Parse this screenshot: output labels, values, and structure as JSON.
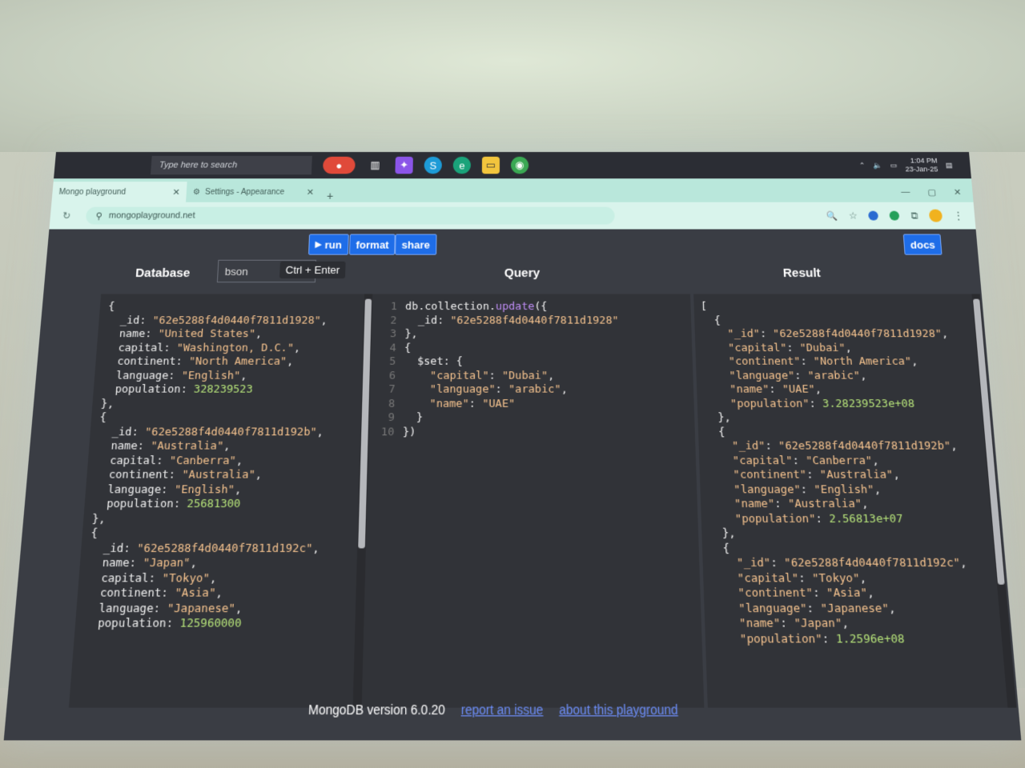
{
  "taskbar": {
    "search_placeholder": "Type here to search",
    "time": "1:04 PM",
    "date": "23-Jan-25"
  },
  "browser": {
    "tabs": [
      {
        "label": "Mongo playground"
      },
      {
        "label": "Settings - Appearance"
      }
    ],
    "url": "mongoplayground.net"
  },
  "toolbar": {
    "run_label": "run",
    "format_label": "format",
    "share_label": "share",
    "docs_label": "docs",
    "run_tooltip": "Ctrl + Enter"
  },
  "panels": {
    "database_title": "Database",
    "mode_value": "bson",
    "query_title": "Query",
    "result_title": "Result"
  },
  "database_lines": [
    "{",
    "  _id: \"62e5288f4d0440f7811d1928\",",
    "  name: \"United States\",",
    "  capital: \"Washington, D.C.\",",
    "  continent: \"North America\",",
    "  language: \"English\",",
    "  population: 328239523",
    "},",
    "{",
    "  _id: \"62e5288f4d0440f7811d192b\",",
    "  name: \"Australia\",",
    "  capital: \"Canberra\",",
    "  continent: \"Australia\",",
    "  language: \"English\",",
    "  population: 25681300",
    "},",
    "{",
    "  _id: \"62e5288f4d0440f7811d192c\",",
    "  name: \"Japan\",",
    "  capital: \"Tokyo\",",
    "  continent: \"Asia\",",
    "  language: \"Japanese\",",
    "  population: 125960000"
  ],
  "query_lines": [
    {
      "num": "1",
      "text": "db.collection.update({"
    },
    {
      "num": "2",
      "text": "  _id: \"62e5288f4d0440f7811d1928\""
    },
    {
      "num": "3",
      "text": "},"
    },
    {
      "num": "4",
      "text": "{"
    },
    {
      "num": "5",
      "text": "  $set: {"
    },
    {
      "num": "6",
      "text": "    \"capital\": \"Dubai\","
    },
    {
      "num": "7",
      "text": "    \"language\": \"arabic\","
    },
    {
      "num": "8",
      "text": "    \"name\": \"UAE\""
    },
    {
      "num": "9",
      "text": "  }"
    },
    {
      "num": "10",
      "text": "})"
    }
  ],
  "result_lines": [
    "[",
    "  {",
    "    \"_id\": \"62e5288f4d0440f7811d1928\",",
    "    \"capital\": \"Dubai\",",
    "    \"continent\": \"North America\",",
    "    \"language\": \"arabic\",",
    "    \"name\": \"UAE\",",
    "    \"population\": 3.28239523e+08",
    "  },",
    "  {",
    "    \"_id\": \"62e5288f4d0440f7811d192b\",",
    "    \"capital\": \"Canberra\",",
    "    \"continent\": \"Australia\",",
    "    \"language\": \"English\",",
    "    \"name\": \"Australia\",",
    "    \"population\": 2.56813e+07",
    "  },",
    "  {",
    "    \"_id\": \"62e5288f4d0440f7811d192c\",",
    "    \"capital\": \"Tokyo\",",
    "    \"continent\": \"Asia\",",
    "    \"language\": \"Japanese\",",
    "    \"name\": \"Japan\",",
    "    \"population\": 1.2596e+08"
  ],
  "footer": {
    "version": "MongoDB version 6.0.20",
    "report_link": "report an issue",
    "about_link": "about this playground"
  },
  "colors": {
    "accent": "#1e6de8",
    "editor_bg": "#313338",
    "string": "#f7c48f",
    "number": "#b6e37a"
  }
}
